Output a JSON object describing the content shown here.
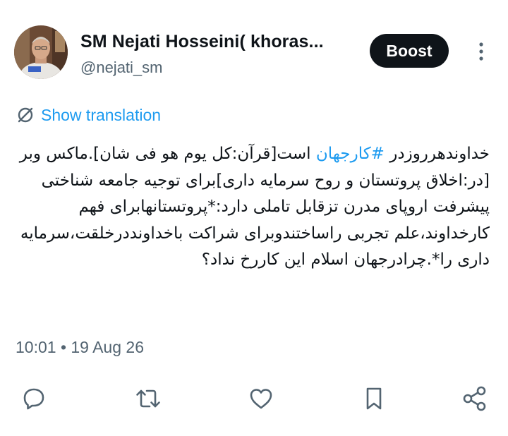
{
  "author": {
    "display_name": "SM Nejati Hosseini( khoras...",
    "handle": "@nejati_sm",
    "avatar_icon": "profile-photo"
  },
  "header": {
    "boost_label": "Boost",
    "more_icon": "more-vertical-icon"
  },
  "translation": {
    "label": "Show translation",
    "icon": "translate-icon"
  },
  "tweet": {
    "text_before": "خداوندهرروزدر ",
    "hashtag": "#کارجهان",
    "text_after": " است[قرآن:کل یوم هو فی شان].ماکس وبر [در:اخلاق پروتستان و روح سرمایه داری]برای توجیه جامعه شناختی پیشرفت اروپای مدرن تزقابل تاملی دارد:*پروتستانهابرای فهم کارخداوند،علم تجربی راساختندوبرای شراکت باخداونددرخلقت،سرمایه داری را*.چرادرجهان اسلام این کاررخ نداد؟",
    "timestamp": "10:01 • 19 Aug 26"
  },
  "actions": [
    {
      "name": "reply-icon"
    },
    {
      "name": "repost-icon"
    },
    {
      "name": "like-icon"
    },
    {
      "name": "bookmark-icon"
    },
    {
      "name": "share-icon"
    }
  ],
  "colors": {
    "accent": "#1d9bf0",
    "text": "#0f1419",
    "secondary": "#536471",
    "icon": "#536471",
    "button_bg": "#0f1419"
  }
}
